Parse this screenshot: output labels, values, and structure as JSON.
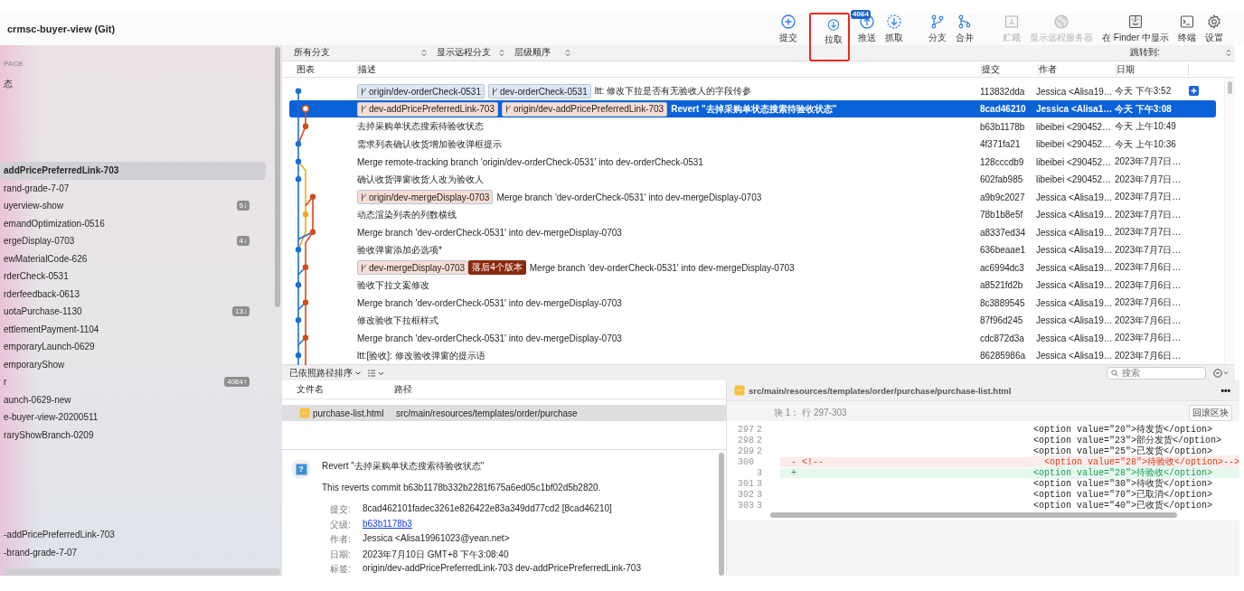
{
  "window": {
    "title": "crmsc-buyer-view (Git)"
  },
  "toolbar": [
    {
      "label": "提交",
      "kind": "commit",
      "disabled": false
    },
    {
      "label": "拉取",
      "kind": "pull",
      "disabled": false
    },
    {
      "label": "推送",
      "kind": "push",
      "disabled": false,
      "badge": "4064"
    },
    {
      "label": "抓取",
      "kind": "fetch",
      "disabled": false
    },
    {
      "label": "分支",
      "kind": "branch",
      "disabled": false
    },
    {
      "label": "合并",
      "kind": "merge",
      "disabled": false
    },
    {
      "label": "贮藏",
      "kind": "stash",
      "disabled": true
    },
    {
      "label": "显示远程服务器",
      "kind": "remote",
      "disabled": true
    },
    {
      "label": "在 Finder 中显示",
      "kind": "finder",
      "disabled": false
    },
    {
      "label": "终端",
      "kind": "terminal",
      "disabled": false
    },
    {
      "label": "设置",
      "kind": "settings",
      "disabled": false
    }
  ],
  "sidebar": {
    "heading": "PACE",
    "status_item": "态",
    "branches": [
      {
        "label": "addPricePreferredLink-703",
        "selected": true
      },
      {
        "label": "rand-grade-7-07",
        "selected": false
      },
      {
        "label": "uyerview-show",
        "selected": false,
        "badge": "5↓"
      },
      {
        "label": "emandOptimization-0516",
        "selected": false
      },
      {
        "label": "ergeDisplay-0703",
        "selected": false,
        "badge": "4↓"
      },
      {
        "label": "ewMaterialCode-626",
        "selected": false
      },
      {
        "label": "rderCheck-0531",
        "selected": false
      },
      {
        "label": "rderfeedback-0613",
        "selected": false
      },
      {
        "label": "uotaPurchase-1130",
        "selected": false,
        "badge": "13↓"
      },
      {
        "label": "ettlementPayment-1104",
        "selected": false
      },
      {
        "label": "emporaryLaunch-0629",
        "selected": false
      },
      {
        "label": "emporaryShow",
        "selected": false
      },
      {
        "label": "r",
        "selected": false,
        "badge": "4064↑"
      },
      {
        "label": "aunch-0629-new",
        "selected": false
      },
      {
        "label": "e-buyer-view-20200511",
        "selected": false
      },
      {
        "label": "raryShowBranch-0209",
        "selected": false
      }
    ],
    "remote_branches": [
      {
        "label": "-addPricePreferredLink-703"
      },
      {
        "label": "-brand-grade-7-07"
      }
    ]
  },
  "filter_bar": {
    "branches": "所有分支",
    "remote": "显示远程分支",
    "order": "层级顺序",
    "jump_label": "跳转到:"
  },
  "commit_list": {
    "columns": [
      "图表",
      "描述",
      "提交",
      "作者",
      "日期"
    ],
    "rows": [
      {
        "refs": [
          {
            "label": "origin/dev-orderCheck-0531",
            "kind": "branch",
            "color": "#dce7f6"
          },
          {
            "label": "dev-orderCheck-0531",
            "kind": "branch",
            "color": "#dce7f6"
          }
        ],
        "message": "ltt: 修改下拉是否有无验收人的字段传参",
        "hash": "113832dda",
        "author": "Jessica <Alisa19…",
        "date": "今天 下午3:52",
        "selected": false
      },
      {
        "refs": [
          {
            "label": "dev-addPricePreferredLink-703",
            "kind": "branch",
            "color": "#f8ddd5"
          },
          {
            "label": "origin/dev-addPricePreferredLink-703",
            "kind": "branch",
            "color": "#f8ddd5"
          }
        ],
        "message": "Revert \"去掉采购单状态搜索待验收状态\"",
        "hash": "8cad46210",
        "author": "Jessica <Alisa1…",
        "date": "今天 下午3:08",
        "selected": true
      },
      {
        "refs": [],
        "message": "去掉采购单状态搜索待验收状态",
        "hash": "b63b1178b",
        "author": "libeibei <290452…",
        "date": "今天 上午10:49",
        "selected": false
      },
      {
        "refs": [],
        "message": "需求列表确认收货增加验收弹框提示",
        "hash": "4f371fa21",
        "author": "libeibei <290452…",
        "date": "今天 上午10:36",
        "selected": false
      },
      {
        "refs": [],
        "message": "Merge remote-tracking branch 'origin/dev-orderCheck-0531' into dev-orderCheck-0531",
        "hash": "128cccdb9",
        "author": "libeibei <290452…",
        "date": "2023年7月7日…",
        "selected": false
      },
      {
        "refs": [],
        "message": "确认收货弹窗收货人改为验收人",
        "hash": "602fab985",
        "author": "libeibei <290452…",
        "date": "2023年7月7日…",
        "selected": false
      },
      {
        "refs": [
          {
            "label": "origin/dev-mergeDisplay-0703",
            "kind": "branch",
            "color": "#f8ddd5"
          }
        ],
        "message": "Merge branch 'dev-orderCheck-0531' into dev-mergeDisplay-0703",
        "hash": "a9b9c2027",
        "author": "Jessica <Alisa19…",
        "date": "2023年7月7日…",
        "selected": false
      },
      {
        "refs": [],
        "message": "动态渲染列表的列数横线",
        "hash": "78b1b8e5f",
        "author": "Jessica <Alisa19…",
        "date": "2023年7月7日…",
        "selected": false
      },
      {
        "refs": [],
        "message": "Merge branch 'dev-orderCheck-0531' into dev-mergeDisplay-0703",
        "hash": "a8337ed34",
        "author": "Jessica <Alisa19…",
        "date": "2023年7月7日…",
        "selected": false
      },
      {
        "refs": [],
        "message": "验收弹窗添加必选项*",
        "hash": "636beaae1",
        "author": "Jessica <Alisa19…",
        "date": "2023年7月7日…",
        "selected": false
      },
      {
        "refs": [
          {
            "label": "dev-mergeDisplay-0703",
            "kind": "branch",
            "color": "#f8ddd5"
          },
          {
            "label": "落后4个版本",
            "kind": "badge",
            "color": "#8a2a0e"
          }
        ],
        "message": "Merge branch 'dev-orderCheck-0531' into dev-mergeDisplay-0703",
        "hash": "ac6994dc3",
        "author": "Jessica <Alisa19…",
        "date": "2023年7月6日…",
        "selected": false
      },
      {
        "refs": [],
        "message": "验收下拉文案修改",
        "hash": "a8521fd2b",
        "author": "Jessica <Alisa19…",
        "date": "2023年7月6日…",
        "selected": false
      },
      {
        "refs": [],
        "message": "Merge branch 'dev-orderCheck-0531' into dev-mergeDisplay-0703",
        "hash": "8c3889545",
        "author": "Jessica <Alisa19…",
        "date": "2023年7月6日…",
        "selected": false
      },
      {
        "refs": [],
        "message": "修改验收下拉框样式",
        "hash": "87f96d245",
        "author": "Jessica <Alisa19…",
        "date": "2023年7月6日…",
        "selected": false
      },
      {
        "refs": [],
        "message": "Merge branch 'dev-orderCheck-0531' into dev-mergeDisplay-0703",
        "hash": "cdc872d3a",
        "author": "Jessica <Alisa19…",
        "date": "2023年7月6日…",
        "selected": false
      },
      {
        "refs": [],
        "message": "ltt:[验收]:  修改验收弹窗的提示语",
        "hash": "86285986a",
        "author": "Jessica <Alisa19…",
        "date": "2023年7月6日…",
        "selected": false
      }
    ]
  },
  "file_list": {
    "sort": "已依照路径排序",
    "columns": [
      "文件名",
      "路径"
    ],
    "files": [
      {
        "name": "purchase-list.html",
        "path": "src/main/resources/templates/order/purchase",
        "selected": true
      }
    ]
  },
  "search": {
    "placeholder": "搜索"
  },
  "commit_detail": {
    "avatar": "?",
    "title": "Revert \"去掉采购单状态搜索待验收状态\"",
    "body": "This reverts commit b63b1178b332b2281f675a6ed05c1bf02d5b2820.",
    "fields": [
      {
        "label": "提交:",
        "value": "8cad462101fadec3261e826422e83a349dd77cd2 [8cad46210]",
        "kind": "text"
      },
      {
        "label": "父级:",
        "value": "b63b1178b3",
        "kind": "link"
      },
      {
        "label": "作者:",
        "value": "Jessica <Alisa19961023@yean.net>",
        "kind": "text"
      },
      {
        "label": "日期:",
        "value": "2023年7月10日 GMT+8 下午3:08:40",
        "kind": "text"
      },
      {
        "label": "标签:",
        "value": "origin/dev-addPricePreferredLink-703 dev-addPricePreferredLink-703",
        "kind": "text"
      }
    ]
  },
  "diff": {
    "path": "src/main/resources/templates/order/purchase/purchase-list.html",
    "more": "•••",
    "hunk": "块 1： 行 297-303",
    "revert_button": "回滚区块",
    "lines": [
      {
        "kind": "context",
        "old": "297",
        "new": "2",
        "code": "<option value=\"20\">待发货</option>"
      },
      {
        "kind": "context",
        "old": "298",
        "new": "2",
        "code": "<option value=\"23\">部分发货</option>"
      },
      {
        "kind": "context",
        "old": "299",
        "new": "2",
        "code": "<option value=\"25\">已发货</option>"
      },
      {
        "kind": "removed",
        "old": "300",
        "sign": "-",
        "prefix": "<!--",
        "code": "<option value=\"28\">待验收</option>-->"
      },
      {
        "kind": "added",
        "new": "3",
        "sign": "+",
        "code": "<option value=\"28\">待验收</option>"
      },
      {
        "kind": "context",
        "old": "301",
        "new": "3",
        "code": "<option value=\"30\">待收货</option>"
      },
      {
        "kind": "context",
        "old": "302",
        "new": "3",
        "code": "<option value=\"70\">已取消</option>"
      },
      {
        "kind": "context",
        "old": "303",
        "new": "3",
        "code": "<option value=\"40\">已收货</option>"
      }
    ]
  }
}
